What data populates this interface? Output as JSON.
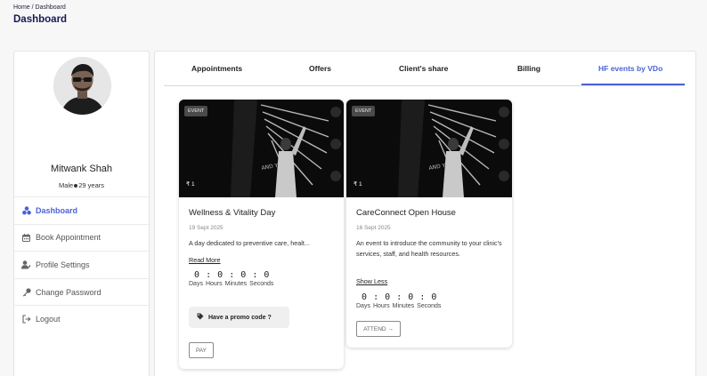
{
  "breadcrumb": {
    "home": "Home",
    "separator": "/",
    "current": "Dashboard"
  },
  "page_title": "Dashboard",
  "profile": {
    "name": "Mitwank Shah",
    "gender": "Male",
    "age": "29 years"
  },
  "sidebar": {
    "items": [
      {
        "label": "Dashboard",
        "icon": "dashboard-icon",
        "active": true
      },
      {
        "label": "Book Appointment",
        "icon": "calendar-icon",
        "active": false
      },
      {
        "label": "Profile Settings",
        "icon": "user-settings-icon",
        "active": false
      },
      {
        "label": "Change Password",
        "icon": "key-icon",
        "active": false
      },
      {
        "label": "Logout",
        "icon": "logout-icon",
        "active": false
      }
    ]
  },
  "tabs": [
    {
      "label": "Appointments",
      "active": false
    },
    {
      "label": "Offers",
      "active": false
    },
    {
      "label": "Client's share",
      "active": false
    },
    {
      "label": "Billing",
      "active": false
    },
    {
      "label": "HF events by VDo",
      "active": true
    }
  ],
  "events": [
    {
      "badge": "EVENT",
      "price": "₹ 1",
      "title": "Wellness & Vitality Day",
      "date": "19 Sept 2025",
      "description": "A day dedicated to preventive care, healt...",
      "toggle_label": "Read More",
      "countdown": {
        "days": "0",
        "hours": "0",
        "minutes": "0",
        "seconds": "0",
        "sep": ":"
      },
      "countdown_labels": [
        "Days",
        "Hours",
        "Minutes",
        "Seconds"
      ],
      "promo_label": "Have a promo code ?",
      "action_label": "PAY"
    },
    {
      "badge": "EVENT",
      "price": "₹ 1",
      "title": "CareConnect Open House",
      "date": "16 Sept 2025",
      "description": "An event to introduce the community to your clinic's services, staff, and health resources.",
      "toggle_label": "Show Less",
      "countdown": {
        "days": "0",
        "hours": "0",
        "minutes": "0",
        "seconds": "0",
        "sep": ":"
      },
      "countdown_labels": [
        "Days",
        "Hours",
        "Minutes",
        "Seconds"
      ],
      "action_label": "ATTEND →"
    }
  ],
  "colors": {
    "accent": "#4b63d8",
    "title": "#161a55",
    "background": "#f7f7f8"
  }
}
